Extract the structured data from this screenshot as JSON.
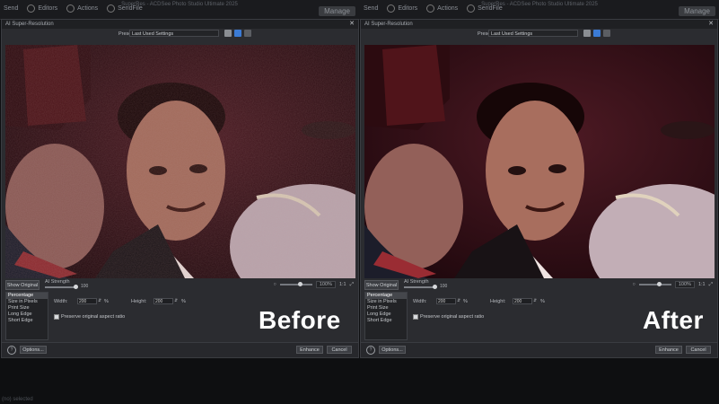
{
  "top_bar": {
    "tabs": [
      "Send",
      "Editors",
      "Actions",
      "SendFile"
    ],
    "window_title": "SuperRes - ACDSee Photo Studio Ultimate 2025",
    "manage_label": "Manage"
  },
  "dialog": {
    "title": "AI Super-Resolution",
    "close_glyph": "✕",
    "preset_label": "Preset:",
    "preset_value": "Last Used Settings",
    "show_original_label": "Show Original",
    "ai_strength_label": "AI Strength",
    "ai_strength_value": "100",
    "zoom_value": "100%",
    "zoom_ratio": "1:1",
    "modes": [
      "Percentage",
      "Size in Pixels",
      "Print Size",
      "Long Edge",
      "Short Edge"
    ],
    "selected_mode": "Percentage",
    "width_label": "Width:",
    "width_value": "200",
    "height_label": "Height:",
    "height_value": "200",
    "percent_sign": "%",
    "preserve_label": "Preserve original aspect ratio",
    "options_label": "Options...",
    "enhance_label": "Enhance",
    "cancel_label": "Cancel",
    "help_glyph": "?"
  },
  "before_label": "Before",
  "after_label": "After",
  "status_text": "(no) selected",
  "colors": {
    "accent_blue": "#3b7bd5",
    "dialog_bg": "#2b2c30",
    "photo_bg": "#2a0d14"
  }
}
